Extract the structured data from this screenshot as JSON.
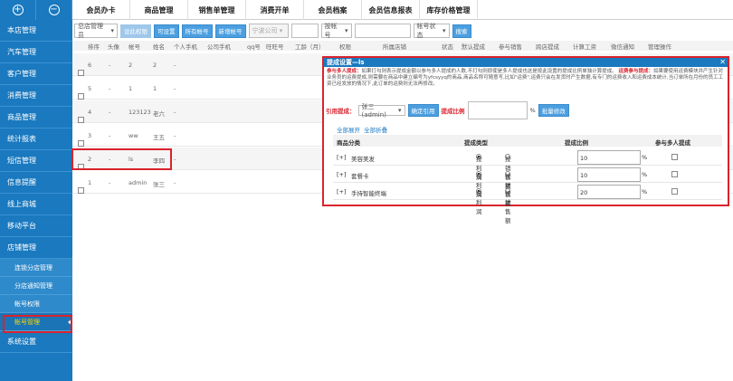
{
  "top": {
    "icons": [
      "plus-circle-icon",
      "minus-circle-icon"
    ],
    "menu": [
      "会员办卡",
      "商品管理",
      "销售单管理",
      "消费开单",
      "会员档案",
      "会员信息报表",
      "库存价格管理"
    ]
  },
  "sidebar": {
    "items": [
      "本店管理",
      "汽车管理",
      "客户管理",
      "消费管理",
      "商品管理",
      "统计报表",
      "短信管理",
      "信息提醒",
      "线上商城",
      "移动平台",
      "店铺管理"
    ],
    "subitems": [
      "连锁分店管理",
      "分店通知管理",
      "帐号权限",
      "帐号管理"
    ],
    "last": "系统设置"
  },
  "toolbar": {
    "store_select": "总店管理员",
    "btn_set_perm": "设此权限",
    "btn_set": "可设置",
    "btn_all_accounts": "所有帐号",
    "btn_add": "新增帐号",
    "select_company": "宁波公司",
    "select_account": "按帐号",
    "select_status": "帐号状态",
    "btn_search": "搜索"
  },
  "table": {
    "headers": [
      "排序",
      "头像",
      "帐号",
      "姓名",
      "个人手机",
      "公司手机",
      "qq号",
      "旺旺号",
      "工龄（月）",
      "权限",
      "所属店铺",
      "状态",
      "默认提成",
      "参与销售",
      "跨店提成",
      "计算工资",
      "微信通知",
      "管理操作"
    ],
    "rows": [
      {
        "sort": "6",
        "avatar": "-",
        "account": "2",
        "name": "2"
      },
      {
        "sort": "5",
        "avatar": "-",
        "account": "1",
        "name": "1"
      },
      {
        "sort": "4",
        "avatar": "-",
        "account": "123123",
        "name": "老六"
      },
      {
        "sort": "3",
        "avatar": "-",
        "account": "ww",
        "name": "王五"
      },
      {
        "sort": "2",
        "avatar": "-",
        "account": "ls",
        "name": "李四"
      },
      {
        "sort": "1",
        "avatar": "-",
        "account": "admin",
        "name": "张三"
      }
    ],
    "dash": "-"
  },
  "modal": {
    "title": "提成设置—ls",
    "close": "✕",
    "note_label1": "参与多人提成：",
    "note1": "如果打勾则表示提成金额以参与多人提成的人数,不打勾则即使是多人提成也这是按此设置的提成比例单独计算提成。",
    "note_label2": "运费参与提成：",
    "note2": "如果要使用运费模块并产生针对业务员的运费提成,则需要在商品中建立编号为yfcsyyq的商品,商品名称可随意写,比如\"运费\",运费只会在发货时产生数据,有专门的运费收入和运费成本统计,当订单所在月份的员工工资已经发放的情况下,此订单的运费则无法再修改。",
    "ref_label": "引用提成：",
    "ref_select": "张三(admin)",
    "btn_confirm_ref": "确定引用",
    "ratio_label": "提成比例",
    "percent": "%",
    "btn_batch": "批量修改",
    "link_expand": "全部展开",
    "link_collapse": "全部折叠",
    "headers": [
      "商品分类",
      "提成类型",
      "提成比例",
      "参与多人提成"
    ],
    "radio_profit": "按利润",
    "radio_sales": "按销售额",
    "rows": [
      {
        "toggle": "[+]",
        "name": "美容美发",
        "ratio": "10"
      },
      {
        "toggle": "[+]",
        "name": "套餐卡",
        "ratio": "10"
      },
      {
        "toggle": "[+]",
        "name": "手持智能终端",
        "ratio": "20"
      }
    ]
  }
}
